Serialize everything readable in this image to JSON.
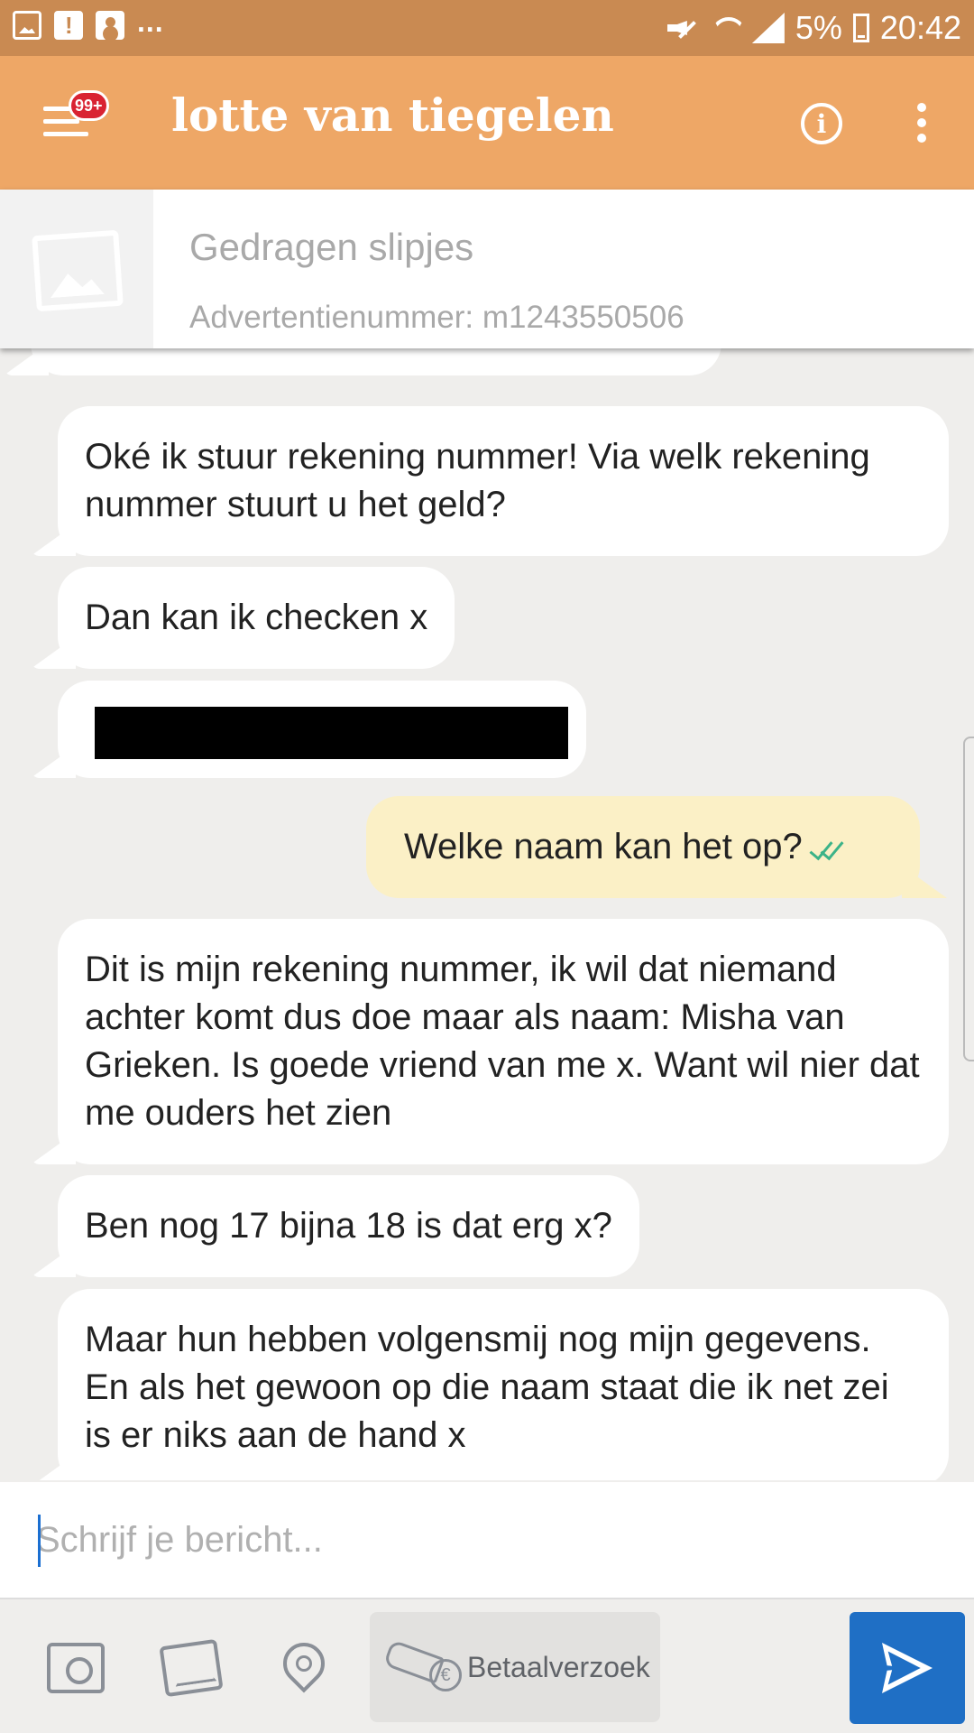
{
  "status_bar": {
    "left_icons": [
      "photo-icon",
      "alert-icon",
      "contact-icon"
    ],
    "more": "...",
    "battery": "5%",
    "time": "20:42"
  },
  "header": {
    "title": "lotte van tiegelen",
    "badge": "99+",
    "bg_color": "#eea766"
  },
  "ad": {
    "title": "Gedragen slipjes",
    "number": "Advertentienummer: m1243550506"
  },
  "messages": [
    {
      "direction": "in",
      "text": "Oké ik stuur rekening nummer! Via welk rekening nummer stuurt u het geld?"
    },
    {
      "direction": "in",
      "text": "Dan kan ik checken x"
    },
    {
      "direction": "in",
      "text": "",
      "redacted": true
    },
    {
      "direction": "out",
      "text": "Welke naam kan het op?",
      "read": true
    },
    {
      "direction": "in",
      "text": "Dit is mijn rekening nummer, ik wil dat niemand achter komt dus doe maar als naam: Misha van Grieken. Is goede vriend van me x. Want wil nier dat me ouders het zien"
    },
    {
      "direction": "in",
      "text": "Ben nog 17 bijna 18 is dat erg x?"
    },
    {
      "direction": "in",
      "text": "Maar hun hebben volgensmij nog mijn gegevens. En als het gewoon op die naam staat die ik net zei is er niks aan de hand x"
    }
  ],
  "composer": {
    "placeholder": "Schrijf je bericht...",
    "value": ""
  },
  "toolbar": {
    "pay_label": "Betaalverzoek",
    "send_color": "#1f6fc5"
  }
}
